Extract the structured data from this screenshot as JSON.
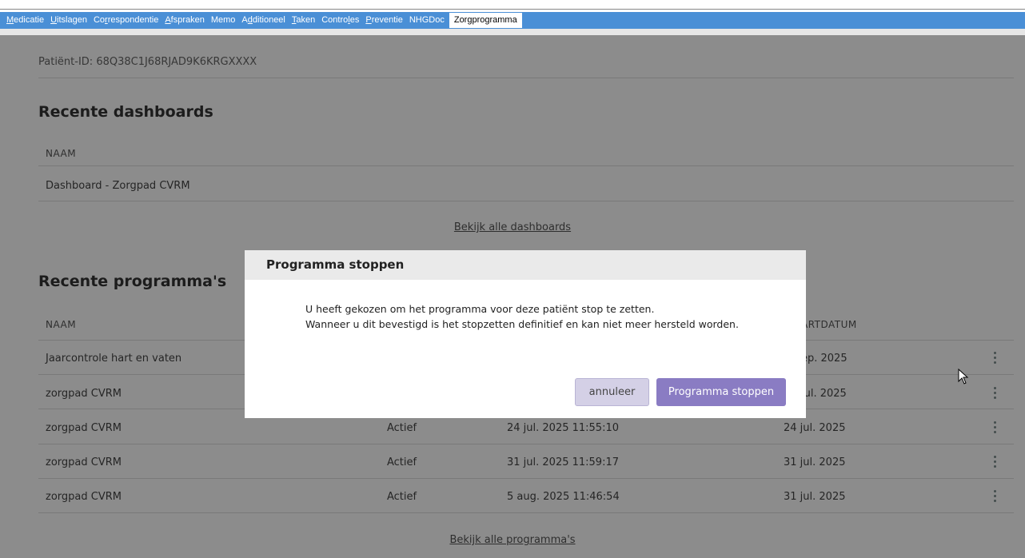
{
  "tabs": [
    {
      "pre": "",
      "ul": "M",
      "post": "edicatie"
    },
    {
      "pre": "",
      "ul": "U",
      "post": "itslagen"
    },
    {
      "pre": "Co",
      "ul": "r",
      "post": "respondentie"
    },
    {
      "pre": "",
      "ul": "A",
      "post": "fspraken"
    },
    {
      "pre": "Memo",
      "ul": "",
      "post": ""
    },
    {
      "pre": "A",
      "ul": "d",
      "post": "ditioneel"
    },
    {
      "pre": "",
      "ul": "T",
      "post": "aken"
    },
    {
      "pre": "Contro",
      "ul": "l",
      "post": "es"
    },
    {
      "pre": "",
      "ul": "P",
      "post": "reventie"
    },
    {
      "pre": "NHGDoc",
      "ul": "",
      "post": ""
    }
  ],
  "active_tab": "Zorgprogramma",
  "patient_id": "Patiënt-ID: 68Q38C1J68RJAD9K6KRGXXXX",
  "dashboards": {
    "title": "Recente dashboards",
    "col_naam": "NAAM",
    "rows": [
      "Dashboard - Zorgpad CVRM"
    ],
    "link": "Bekijk alle dashboards"
  },
  "programmas": {
    "title": "Recente programma's",
    "col_naam": "NAAM",
    "col_startdatum": "ARTDATUM",
    "rows": [
      {
        "naam": "Jaarcontrole hart en vaten",
        "status": "",
        "datum": "",
        "start": "ep. 2025"
      },
      {
        "naam": "zorgpad CVRM",
        "status": "",
        "datum": "",
        "start": "jul. 2025"
      },
      {
        "naam": "zorgpad CVRM",
        "status": "Actief",
        "datum": "24 jul. 2025 11:55:10",
        "start": "24 jul. 2025"
      },
      {
        "naam": "zorgpad CVRM",
        "status": "Actief",
        "datum": "31 jul. 2025 11:59:17",
        "start": "31 jul. 2025"
      },
      {
        "naam": "zorgpad CVRM",
        "status": "Actief",
        "datum": "5 aug. 2025 11:46:54",
        "start": "31 jul. 2025"
      }
    ],
    "link": "Bekijk alle programma's"
  },
  "modal": {
    "title": "Programma stoppen",
    "line1": "U heeft gekozen om het programma voor deze patiënt stop te zetten.",
    "line2": "Wanneer u dit bevestigd is het stopzetten definitief en kan niet meer hersteld worden.",
    "cancel": "annuleer",
    "confirm": "Programma stoppen"
  },
  "colors": {
    "tabbar": "#4a8fd6",
    "overlay": "rgba(0,0,0,0.45)",
    "confirm": "#8a7cc3",
    "cancel": "#d4d0e6"
  }
}
